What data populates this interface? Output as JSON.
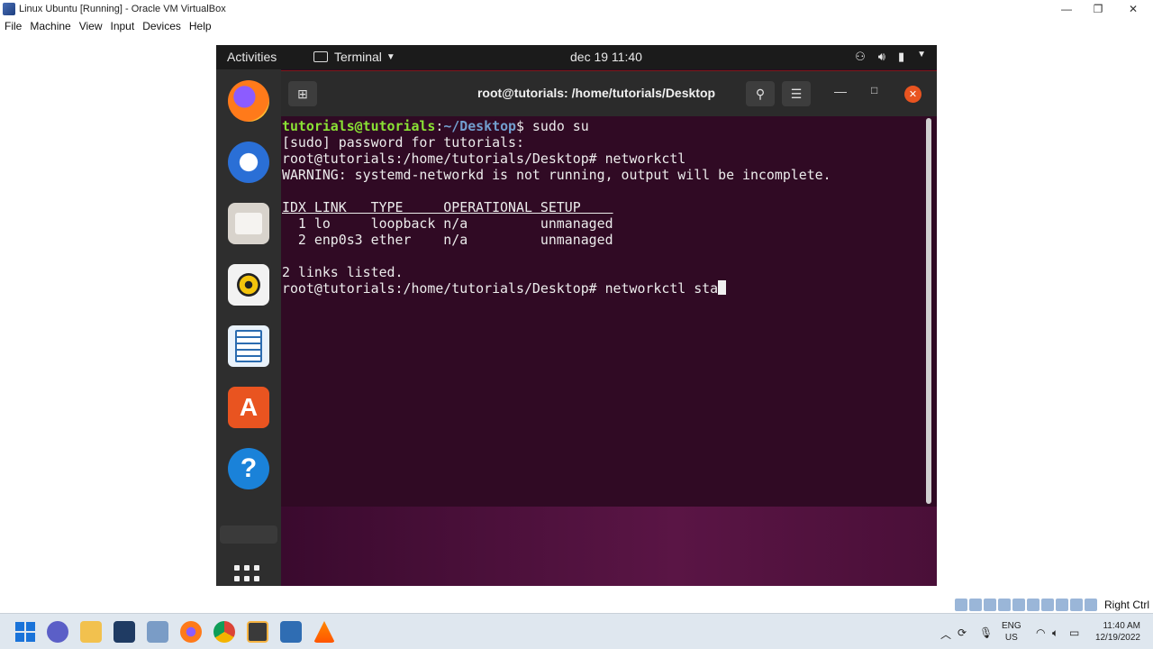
{
  "host": {
    "title": "Linux Ubuntu [Running] - Oracle VM VirtualBox",
    "menu": [
      "File",
      "Machine",
      "View",
      "Input",
      "Devices",
      "Help"
    ],
    "controls": {
      "minimize": "—",
      "restore": "❐",
      "close": "✕"
    },
    "status_right": "Right Ctrl"
  },
  "ubuntu": {
    "activities": "Activities",
    "app_name": "Terminal",
    "clock": "dec 19  11:40",
    "tray": [
      "network-icon",
      "volume-icon",
      "battery-icon",
      "menu-arrow-icon"
    ]
  },
  "dock": {
    "items": [
      "firefox",
      "thunderbird",
      "files",
      "rhythmbox",
      "libreoffice-writer",
      "ubuntu-software",
      "help"
    ],
    "help_glyph": "?",
    "software_glyph": "A"
  },
  "terminal": {
    "title": "root@tutorials: /home/tutorials/Desktop",
    "line1_user": "tutorials@tutorials",
    "line1_sep": ":",
    "line1_path": "~/Desktop",
    "line1_cmd": "$ sudo su",
    "line2": "[sudo] password for tutorials:",
    "line3": "root@tutorials:/home/tutorials/Desktop# networkctl",
    "line4": "WARNING: systemd-networkd is not running, output will be incomplete.",
    "table_header": "IDX LINK   TYPE     OPERATIONAL SETUP    ",
    "table_rows": [
      "  1 lo     loopback n/a         unmanaged",
      "  2 enp0s3 ether    n/a         unmanaged"
    ],
    "summary": "2 links listed.",
    "current_prompt": "root@tutorials:/home/tutorials/Desktop# networkctl sta"
  },
  "taskbar": {
    "lang_line1": "ENG",
    "lang_line2": "US",
    "time": "11:40 AM",
    "date": "12/19/2022"
  }
}
